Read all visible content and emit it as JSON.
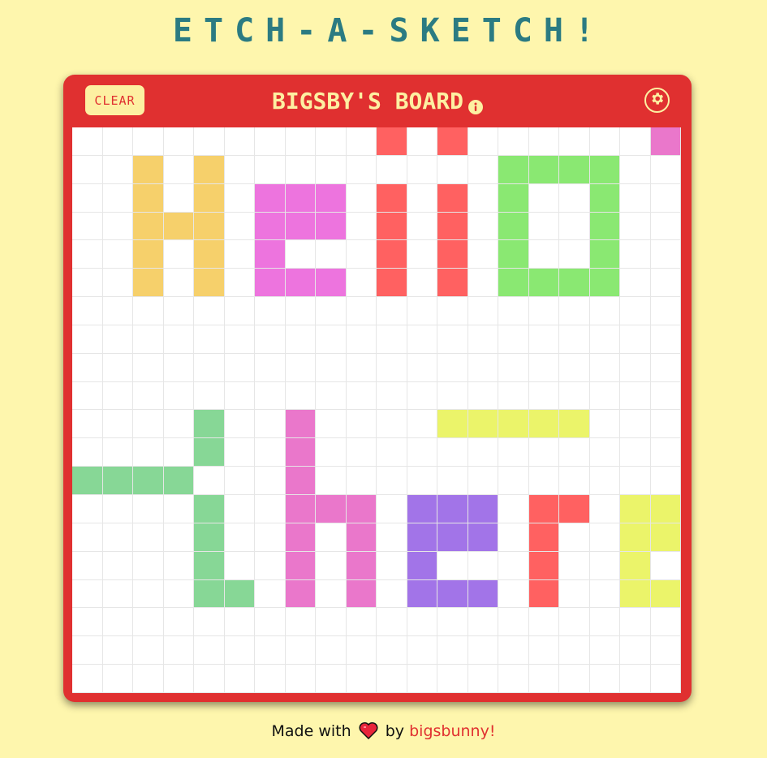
{
  "header": {
    "app_title": "ETCH-A-SKETCH!"
  },
  "board": {
    "clear_label": "CLEAR",
    "title": "BIGSBY'S BOARD",
    "info_icon": "info-icon",
    "settings_icon": "gear-icon",
    "grid_size": 20,
    "palette": {
      "Y": "#f6d06b",
      "M": "#ed74de",
      "R": "#ff6161",
      "G": "#8ae872",
      "T": "#87d796",
      "P": "#ea77cb",
      "L": "#ebf46a",
      "V": "#a274e8"
    },
    "rows": [
      "..........R.R......P",
      "..Y.Y.........GGGG..",
      "..Y.Y.MMM.R.R.G..G..",
      "..YYY.MMM.R.R.G..G..",
      "..Y.Y.M...R.R.G..G..",
      "..Y.Y.MMM.R.R.GGGG..",
      "....................",
      "....................",
      "....................",
      "....................",
      "....T..P....LLLLL...",
      "....T..P............",
      "TTTT...P............",
      "....T..PPP.VVV.RR.LLL.",
      "....T..P.P.VVV.R..LLL.",
      "....T..P.P.V...R..L...",
      "....TT.P.P.VVV.R..LLL.",
      "....................",
      "....................",
      "...................."
    ]
  },
  "footer": {
    "made_with": "Made with",
    "heart_icon": "heart-icon",
    "by": "by",
    "author": "bigsbunny!"
  },
  "colors": {
    "background": "#fef6ad",
    "title": "#2b7b82",
    "board": "#e03030",
    "button_bg": "#fdf0a2"
  }
}
